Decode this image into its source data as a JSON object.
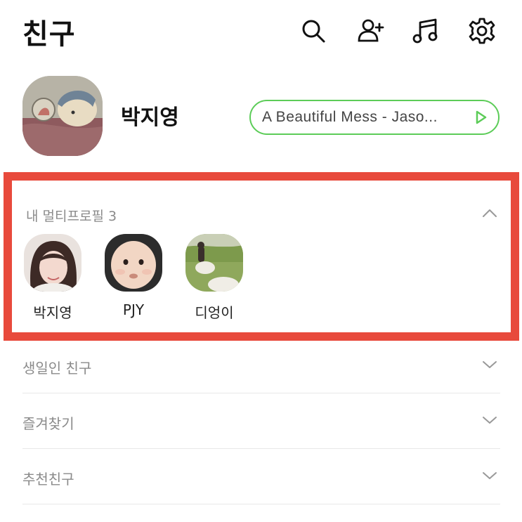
{
  "header": {
    "title": "친구",
    "icons": [
      "search-icon",
      "add-friend-icon",
      "music-icon",
      "settings-icon"
    ]
  },
  "profile": {
    "name": "박지영",
    "music": "A Beautiful Mess - Jaso...",
    "accent_color": "#5ccc58"
  },
  "multi_profile": {
    "header": "내 멀티프로필 3",
    "highlight_color": "#e84a3c",
    "items": [
      {
        "label": "박지영"
      },
      {
        "label": "PJY"
      },
      {
        "label": "디엉이"
      }
    ]
  },
  "sections": [
    {
      "label": "생일인 친구"
    },
    {
      "label": "즐겨찾기"
    },
    {
      "label": "추천친구"
    }
  ]
}
